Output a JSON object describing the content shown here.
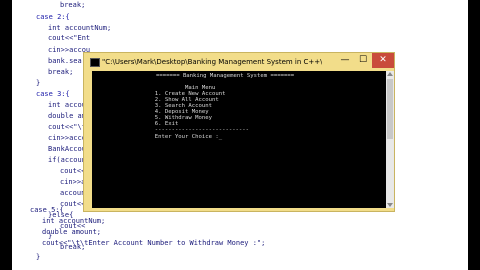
{
  "editor": {
    "lines": [
      {
        "text": "break;"
      },
      {
        "text": "case 2:{"
      },
      {
        "text": "int accountNum;"
      },
      {
        "text": "cout<<\"Ent"
      },
      {
        "text": "cin>>accou"
      },
      {
        "text": "bank.searc"
      },
      {
        "text": "break;"
      },
      {
        "text": "}"
      },
      {
        "text": "case 3:{"
      },
      {
        "text": "int accoun"
      },
      {
        "text": "double amo"
      },
      {
        "text": "cout<<\"\\t\\"
      },
      {
        "text": "cin>>accou"
      },
      {
        "text": "BankAccou"
      },
      {
        "text": "if(accoun"
      },
      {
        "text": "cout<<"
      },
      {
        "text": "cin>>a"
      },
      {
        "text": "accoun"
      },
      {
        "text": "cout<<"
      },
      {
        "text": "}else{"
      },
      {
        "text": "cout<<"
      },
      {
        "text": "}"
      },
      {
        "text": "break;"
      },
      {
        "text": "}"
      },
      {
        "text": "case 5:{"
      },
      {
        "text": "int accountNum;"
      },
      {
        "text": "double amount;"
      },
      {
        "text": "cout<<\"\\t\\tEnter Account Number to Withdraw Money :\";"
      }
    ]
  },
  "console": {
    "title": "\"C:\\Users\\Mark\\Desktop\\Banking Management System in C++\\Banking Manag...",
    "min_glyph": "—",
    "max_glyph": "☐",
    "close_glyph": "✕",
    "output": [
      "======= Banking Management System =======",
      "",
      "           Main Menu",
      "  1. Create New Account",
      "  2. Show All Account",
      "  3. Search Account",
      "  4. Deposit Money",
      "  5. Withdraw Money",
      "  6. Exit",
      "  ----------------------------",
      "  Enter Your Choice :_"
    ]
  }
}
